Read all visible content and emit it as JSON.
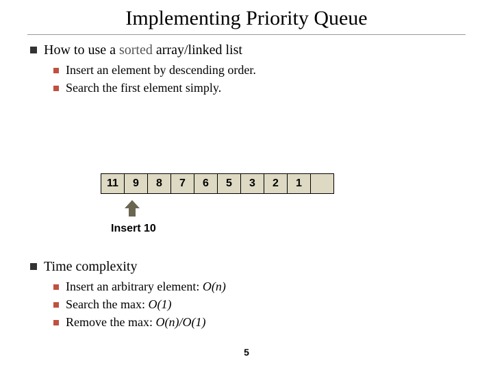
{
  "title": "Implementing Priority Queue",
  "bullets": {
    "l1a_prefix": "How to use a ",
    "l1a_sorted": "sorted",
    "l1a_suffix": " array/linked list",
    "l2a": "Insert an element by descending order.",
    "l2b": "Search the first element simply.",
    "l1b": "Time complexity",
    "l2c_prefix": "Insert an arbitrary element: ",
    "l2c_math": "O(n)",
    "l2d_prefix": "Search the max: ",
    "l2d_math": "O(1)",
    "l2e_prefix": "Remove the max: ",
    "l2e_math": "O(n)/O(1)"
  },
  "array_cells": [
    "11",
    "9",
    "8",
    "7",
    "6",
    "5",
    "3",
    "2",
    "1",
    ""
  ],
  "insert_label": "Insert 10",
  "page_number": "5"
}
